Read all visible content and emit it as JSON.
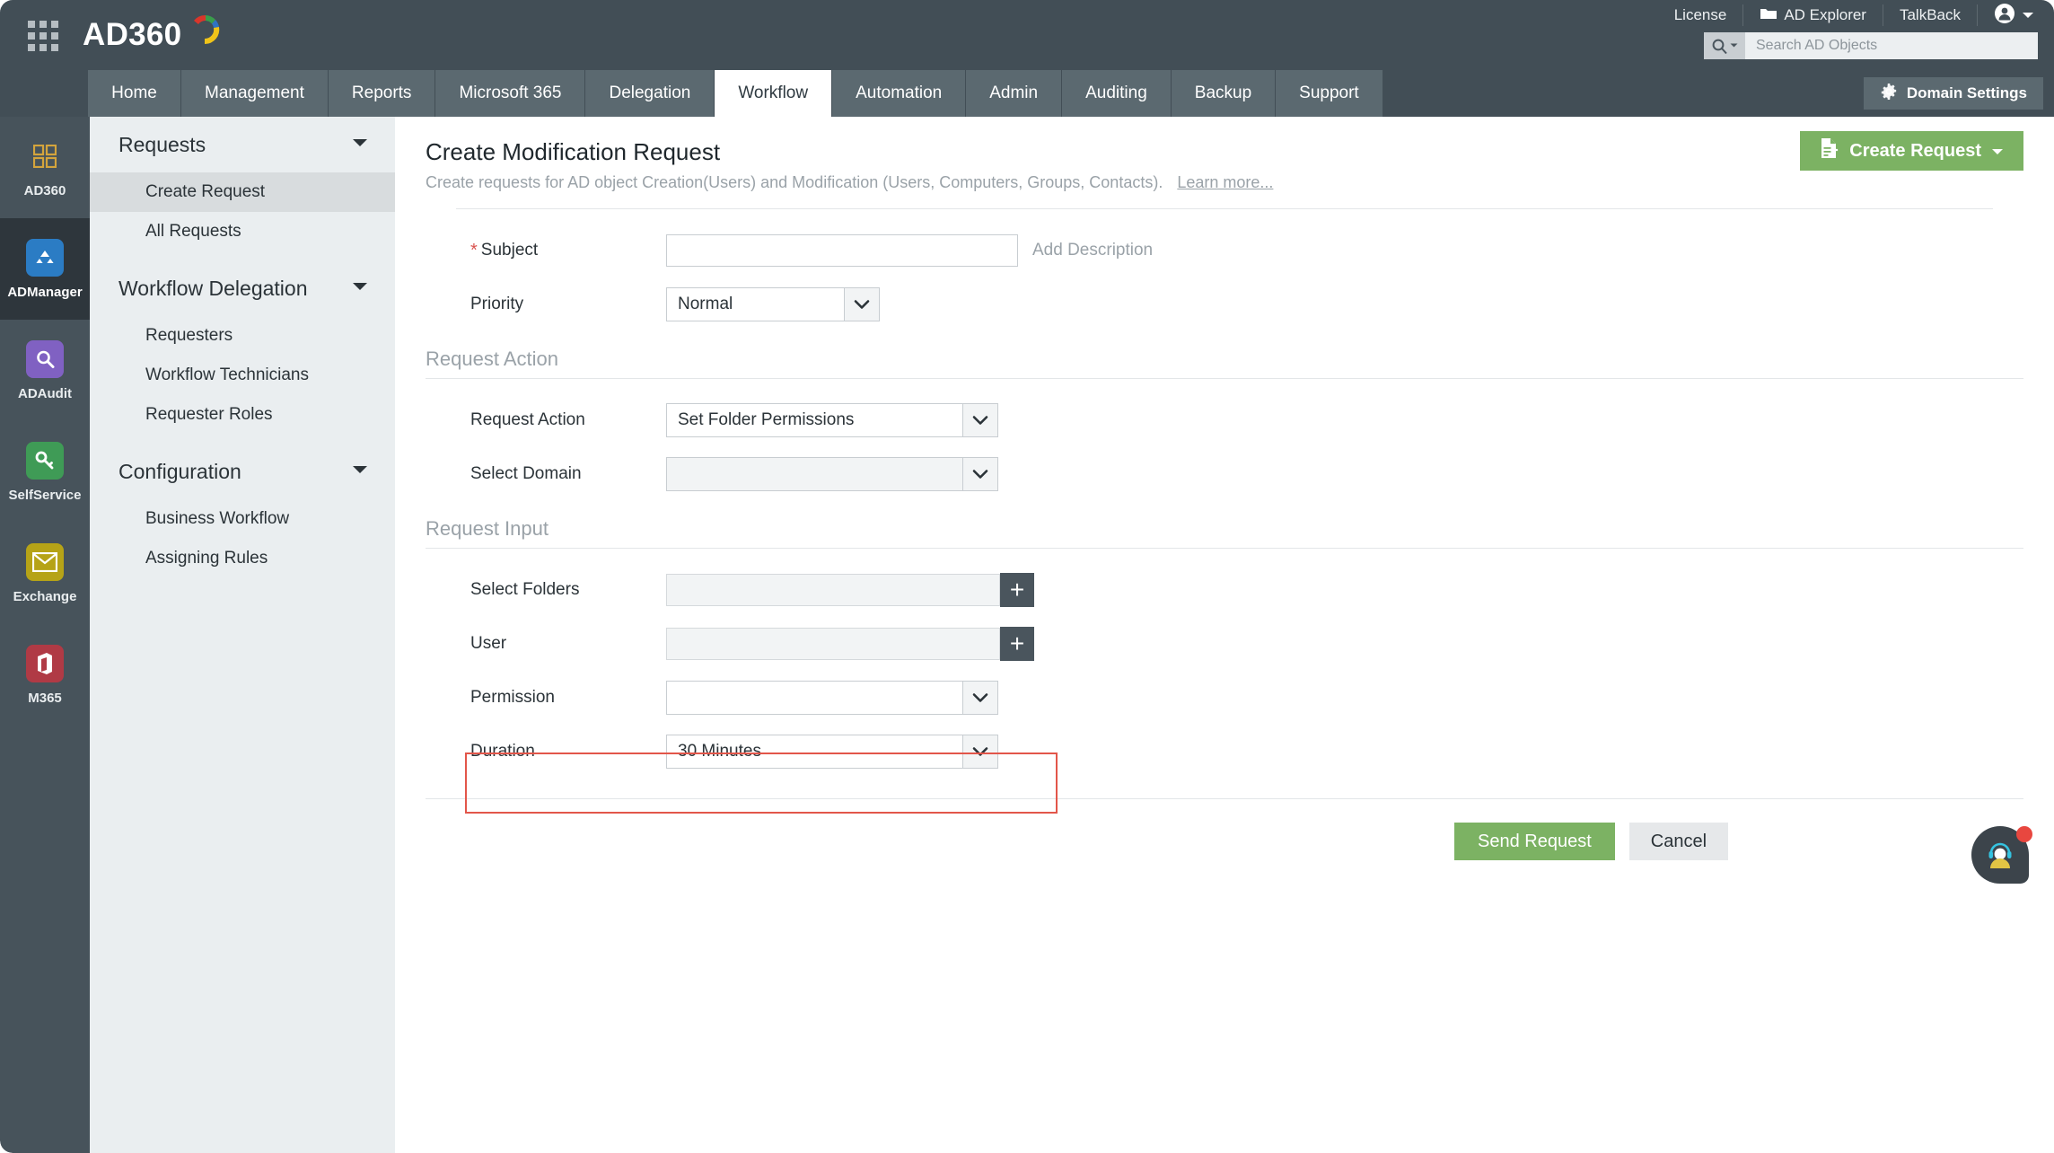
{
  "topbar": {
    "app_name": "AD360",
    "waffle_icon": "apps-grid-icon",
    "right_items": [
      {
        "label": "License",
        "icon": null,
        "name": "license"
      },
      {
        "label": "AD Explorer",
        "icon": "folder-icon",
        "name": "ad-explorer"
      },
      {
        "label": "TalkBack",
        "icon": null,
        "name": "talkback"
      },
      {
        "label": "",
        "icon": "user-account-icon",
        "name": "account"
      }
    ],
    "search": {
      "placeholder": "Search AD Objects",
      "value": "",
      "icon": "search-icon"
    }
  },
  "nav": {
    "tabs": [
      {
        "label": "Home",
        "active": false
      },
      {
        "label": "Management",
        "active": false
      },
      {
        "label": "Reports",
        "active": false
      },
      {
        "label": "Microsoft 365",
        "active": false
      },
      {
        "label": "Delegation",
        "active": false
      },
      {
        "label": "Workflow",
        "active": true
      },
      {
        "label": "Automation",
        "active": false
      },
      {
        "label": "Admin",
        "active": false
      },
      {
        "label": "Auditing",
        "active": false
      },
      {
        "label": "Backup",
        "active": false
      },
      {
        "label": "Support",
        "active": false
      }
    ],
    "domain_settings": {
      "label": "Domain Settings",
      "icon": "gear-icon"
    }
  },
  "rail": {
    "items": [
      {
        "label": "AD360",
        "icon": "squares-icon",
        "color": "#d4a43c",
        "active": false
      },
      {
        "label": "ADManager",
        "icon": "admanager-icon",
        "color": "#2b7cc4",
        "active": true
      },
      {
        "label": "ADAudit",
        "icon": "magnifier-icon",
        "color": "#8061c2",
        "active": false
      },
      {
        "label": "SelfService",
        "icon": "key-icon",
        "color": "#3f9b56",
        "active": false
      },
      {
        "label": "Exchange",
        "icon": "envelope-icon",
        "color": "#b6a317",
        "active": false
      },
      {
        "label": "M365",
        "icon": "office-icon",
        "color": "#b03a45",
        "active": false
      }
    ]
  },
  "submenu": {
    "groups": [
      {
        "label": "Requests",
        "chevron": "chevron-down-icon",
        "items": [
          {
            "label": "Create Request",
            "active": true
          },
          {
            "label": "All Requests",
            "active": false
          }
        ]
      },
      {
        "label": "Workflow Delegation",
        "chevron": "chevron-down-icon",
        "items": [
          {
            "label": "Requesters",
            "active": false
          },
          {
            "label": "Workflow Technicians",
            "active": false
          },
          {
            "label": "Requester Roles",
            "active": false
          }
        ]
      },
      {
        "label": "Configuration",
        "chevron": "chevron-down-icon",
        "items": [
          {
            "label": "Business Workflow",
            "active": false
          },
          {
            "label": "Assigning Rules",
            "active": false
          }
        ]
      }
    ]
  },
  "main": {
    "title": "Create Modification Request",
    "subtitle": "Create requests for AD object Creation(Users) and Modification (Users, Computers, Groups, Contacts).",
    "learn_more": "Learn more...",
    "create_request_button": {
      "label": "Create Request",
      "icon": "document-add-icon",
      "caret": "caret-down-icon",
      "color": "#7cb263"
    },
    "fields": {
      "subject": {
        "label": "Subject",
        "required": true,
        "value": "",
        "placeholder": ""
      },
      "add_description": "Add Description",
      "priority": {
        "label": "Priority",
        "value": "Normal"
      }
    },
    "request_action_section": {
      "title": "Request Action",
      "request_action": {
        "label": "Request Action",
        "value": "Set Folder Permissions"
      },
      "select_domain": {
        "label": "Select Domain",
        "value": ""
      }
    },
    "request_input_section": {
      "title": "Request Input",
      "select_folders": {
        "label": "Select Folders",
        "value": "",
        "add_icon": "plus-icon"
      },
      "user": {
        "label": "User",
        "value": "",
        "add_icon": "plus-icon"
      },
      "permission": {
        "label": "Permission",
        "value": ""
      },
      "duration": {
        "label": "Duration",
        "value": "30 Minutes",
        "highlighted": true,
        "highlight_color": "#e2564a"
      }
    },
    "actions": {
      "send": "Send Request",
      "cancel": "Cancel"
    }
  },
  "chat_widget": {
    "icon": "support-agent-icon",
    "badge": true,
    "badge_color": "#e8473f"
  }
}
